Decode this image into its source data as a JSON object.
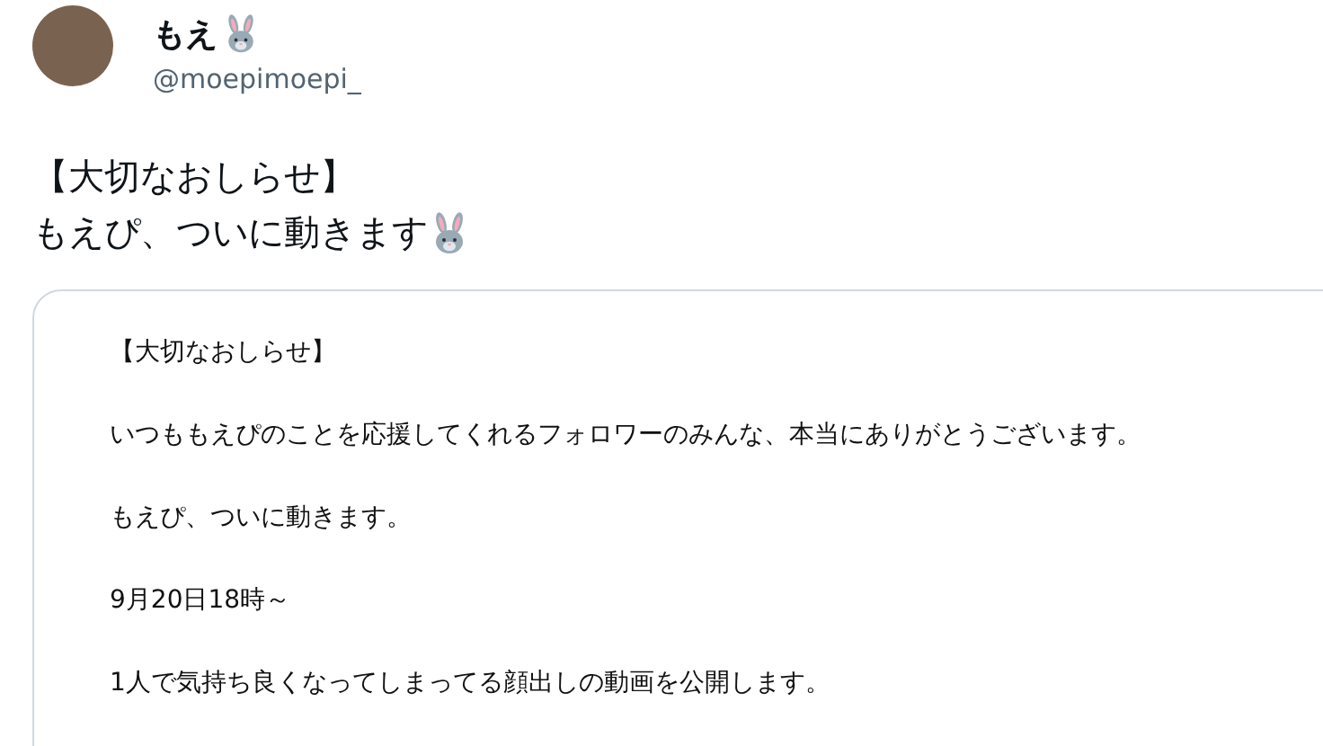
{
  "author": {
    "name": "もえ",
    "handle": "@moepimoepi_"
  },
  "tweet_lines": [
    "【大切なおしらせ】",
    "もえぴ、ついに動きます"
  ],
  "attached_document": {
    "paragraphs": [
      "【大切なおしらせ】",
      "いつももえぴのことを応援してくれるフォロワーのみんな、本当にありがとうございます。",
      "もえぴ、ついに動きます。",
      "9月20日18時～",
      "1人で気持ち良くなってしまってる顔出しの動画を公開します。"
    ]
  }
}
